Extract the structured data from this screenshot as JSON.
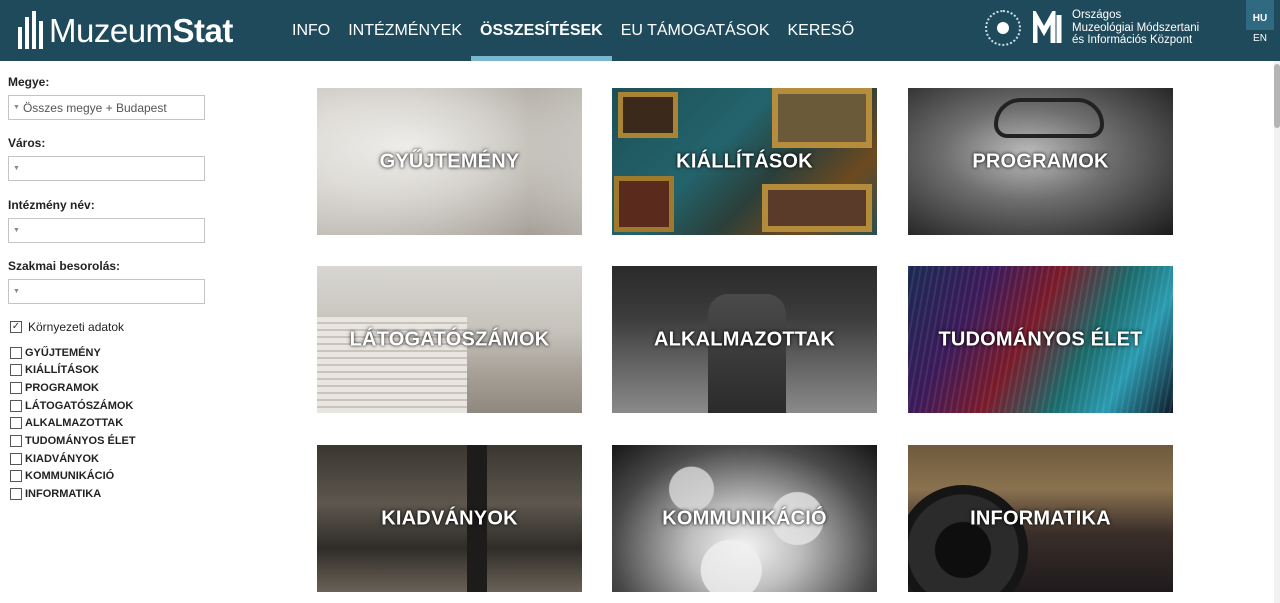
{
  "header": {
    "logo_regular": "Muzeum",
    "logo_bold": "Stat",
    "nav": [
      {
        "label": "INFO"
      },
      {
        "label": "INTÉZMÉNYEK"
      },
      {
        "label": "ÖSSZESÍTÉSEK"
      },
      {
        "label": "EU TÁMOGATÁSOK"
      },
      {
        "label": "KERESŐ"
      }
    ],
    "active_nav": "ÖSSZESÍTÉSEK",
    "partner": {
      "line1": "Országos",
      "line2": "Muzeológiai Módszertani",
      "line3": "és Információs Központ"
    },
    "lang": [
      {
        "label": "HU"
      },
      {
        "label": "EN"
      }
    ],
    "active_lang": "HU",
    "colors": {
      "background": "#1f4a5c",
      "active_underline": "#79b7cf",
      "lang_active": "#2f6a82"
    }
  },
  "sidebar": {
    "megye_label": "Megye:",
    "megye_value": "Összes megye + Budapest",
    "varos_label": "Város:",
    "varos_value": "",
    "intezmeny_label": "Intézmény név:",
    "intezmeny_value": "",
    "szakmai_label": "Szakmai besorolás:",
    "szakmai_value": "",
    "env_label": "Környezeti adatok",
    "env_checked": true,
    "categories": [
      {
        "label": "GYŰJTEMÉNY",
        "checked": false
      },
      {
        "label": "KIÁLLÍTÁSOK",
        "checked": false
      },
      {
        "label": "PROGRAMOK",
        "checked": false
      },
      {
        "label": "LÁTOGATÓSZÁMOK",
        "checked": false
      },
      {
        "label": "ALKALMAZOTTAK",
        "checked": false
      },
      {
        "label": "TUDOMÁNYOS ÉLET",
        "checked": false
      },
      {
        "label": "KIADVÁNYOK",
        "checked": false
      },
      {
        "label": "KOMMUNIKÁCIÓ",
        "checked": false
      },
      {
        "label": "INFORMATIKA",
        "checked": false
      }
    ]
  },
  "tiles": [
    {
      "label": "GYŰJTEMÉNY"
    },
    {
      "label": "KIÁLLÍTÁSOK"
    },
    {
      "label": "PROGRAMOK"
    },
    {
      "label": "LÁTOGATÓSZÁMOK"
    },
    {
      "label": "ALKALMAZOTTAK"
    },
    {
      "label": "TUDOMÁNYOS ÉLET"
    },
    {
      "label": "KIADVÁNYOK"
    },
    {
      "label": "KOMMUNIKÁCIÓ"
    },
    {
      "label": "INFORMATIKA"
    }
  ]
}
